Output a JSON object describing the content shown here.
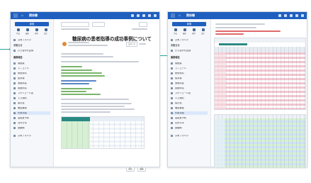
{
  "left_window": {
    "app_title": "関係職",
    "new_button": "新規",
    "quick": [
      "作成",
      "最新",
      "検索",
      "設定"
    ],
    "sidebar_items": [
      "共有フォルダ",
      "お知らせ",
      "打ち合わせ記録",
      "業務報告",
      "規程集",
      "マニュアル",
      "研修資料",
      "議事録",
      "業務改善",
      "各種申請",
      "スケジュール表",
      "入力規則",
      "集計表",
      "備品管理",
      "作業手順",
      "会議室予約",
      "社内行事",
      "連絡網"
    ],
    "document": {
      "title": "糖尿病の患者指導の成功事例について",
      "comments_label": "コメント",
      "reply_label": "返信",
      "edit_label": "編集"
    }
  },
  "right_window": {
    "app_title": "関係職",
    "new_button": "新規",
    "quick": [
      "作成",
      "最新",
      "検索",
      "設定"
    ],
    "sidebar_items": [
      "共有フォルダ",
      "お知らせ",
      "打ち合わせ記録",
      "業務報告",
      "規程集",
      "マニュアル",
      "研修資料",
      "議事録",
      "業務改善",
      "各種申請",
      "スケジュール表",
      "入力規則",
      "集計表",
      "備品管理",
      "作業手順",
      "会議室予約",
      "社内行事",
      "連絡網"
    ]
  },
  "colors": {
    "header_blue": "#1f5fbf",
    "accent_teal": "#2aa39a",
    "sheet_pink": "#f4c6d0",
    "sheet_green": "#d7f0d3",
    "sheet_blue": "#cfe2f7"
  }
}
